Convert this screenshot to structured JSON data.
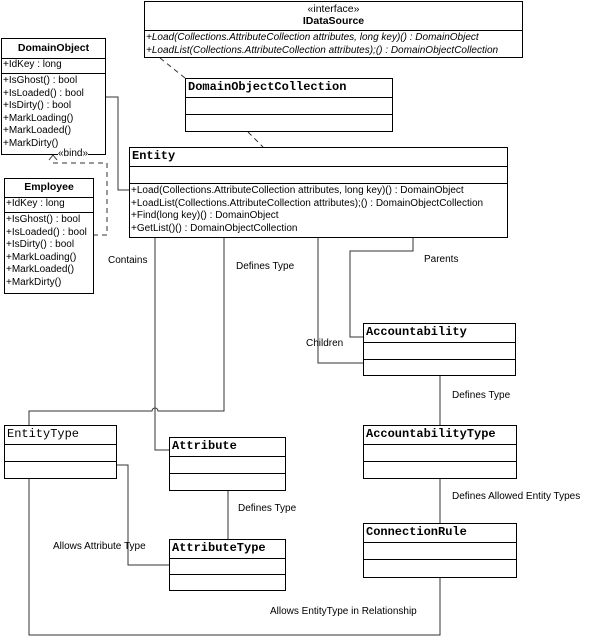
{
  "classes": {
    "idatasource": {
      "stereotype": "«interface»",
      "name": "IDataSource",
      "methods": [
        "+Load(Collections.AttributeCollection attributes, long key)() : DomainObject",
        "+LoadList(Collections.AttributeCollection attributes);() : DomainObjectCollection"
      ]
    },
    "domainobject": {
      "name": "DomainObject",
      "attributes": [
        "+IdKey : long"
      ],
      "methods": [
        "+IsGhost() : bool",
        "+IsLoaded() : bool",
        "+IsDirty() : bool",
        "+MarkLoading()",
        "+MarkLoaded()",
        "+MarkDirty()"
      ]
    },
    "employee": {
      "name": "Employee",
      "attributes": [
        "+IdKey : long"
      ],
      "methods": [
        "+IsGhost() : bool",
        "+IsLoaded() : bool",
        "+IsDirty() : bool",
        "+MarkLoading()",
        "+MarkLoaded()",
        "+MarkDirty()"
      ]
    },
    "domainobjectcollection": {
      "name": "DomainObjectCollection"
    },
    "entity": {
      "name": "Entity",
      "methods": [
        "+Load(Collections.AttributeCollection attributes, long key)() : DomainObject",
        "+LoadList(Collections.AttributeCollection attributes);() : DomainObjectCollection",
        "+Find(long key)() : DomainObject",
        "+GetList()() : DomainObjectCollection"
      ]
    },
    "accountability": {
      "name": "Accountability"
    },
    "accountabilitytype": {
      "name": "AccountabilityType"
    },
    "connectionrule": {
      "name": "ConnectionRule"
    },
    "entitytype": {
      "name": "EntityType"
    },
    "attribute": {
      "name": "Attribute"
    },
    "attributetype": {
      "name": "AttributeType"
    }
  },
  "labels": {
    "bind": "«bind»",
    "contains": "Contains",
    "defines_type_entity": "Defines Type",
    "parents": "Parents",
    "children": "Children",
    "defines_type_accountability": "Defines Type",
    "defines_allowed": "Defines Allowed Entity Types",
    "defines_type_attribute": "Defines Type",
    "allows_attribute_type": "Allows Attribute Type",
    "allows_entitytype": "Allows EntityType in Relationship"
  }
}
